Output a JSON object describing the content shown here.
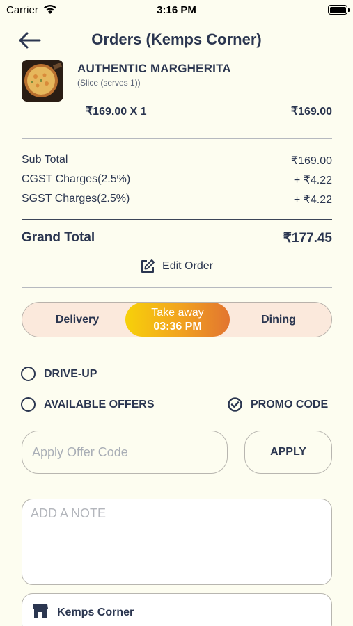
{
  "status_bar": {
    "carrier": "Carrier",
    "time": "3:16 PM"
  },
  "header": {
    "title": "Orders (Kemps Corner)"
  },
  "item": {
    "name": "AUTHENTIC MARGHERITA",
    "variant": "(Slice (serves 1))",
    "qty_line": "₹169.00 X 1",
    "total": "₹169.00"
  },
  "summary": {
    "sub_total_label": "Sub Total",
    "sub_total_value": "₹169.00",
    "cgst_label": "CGST Charges(2.5%)",
    "cgst_value": "+ ₹4.22",
    "sgst_label": "SGST Charges(2.5%)",
    "sgst_value": "+ ₹4.22",
    "grand_total_label": "Grand Total",
    "grand_total_value": "₹177.45"
  },
  "edit_order_label": "Edit Order",
  "order_mode": {
    "delivery": "Delivery",
    "takeaway": "Take away",
    "takeaway_time": "03:36 PM",
    "dining": "Dining",
    "selected": "takeaway"
  },
  "options": {
    "drive_up": "DRIVE-UP",
    "available_offers": "AVAILABLE OFFERS",
    "promo_code": "PROMO CODE"
  },
  "offer": {
    "placeholder": "Apply Offer Code",
    "apply_label": "APPLY"
  },
  "note": {
    "placeholder": "ADD A NOTE"
  },
  "store": {
    "name": "Kemps Corner"
  },
  "colors": {
    "background": "#fdfdf0",
    "text": "#2b3650",
    "accent_start": "#f7d10a",
    "accent_end": "#e27530"
  }
}
